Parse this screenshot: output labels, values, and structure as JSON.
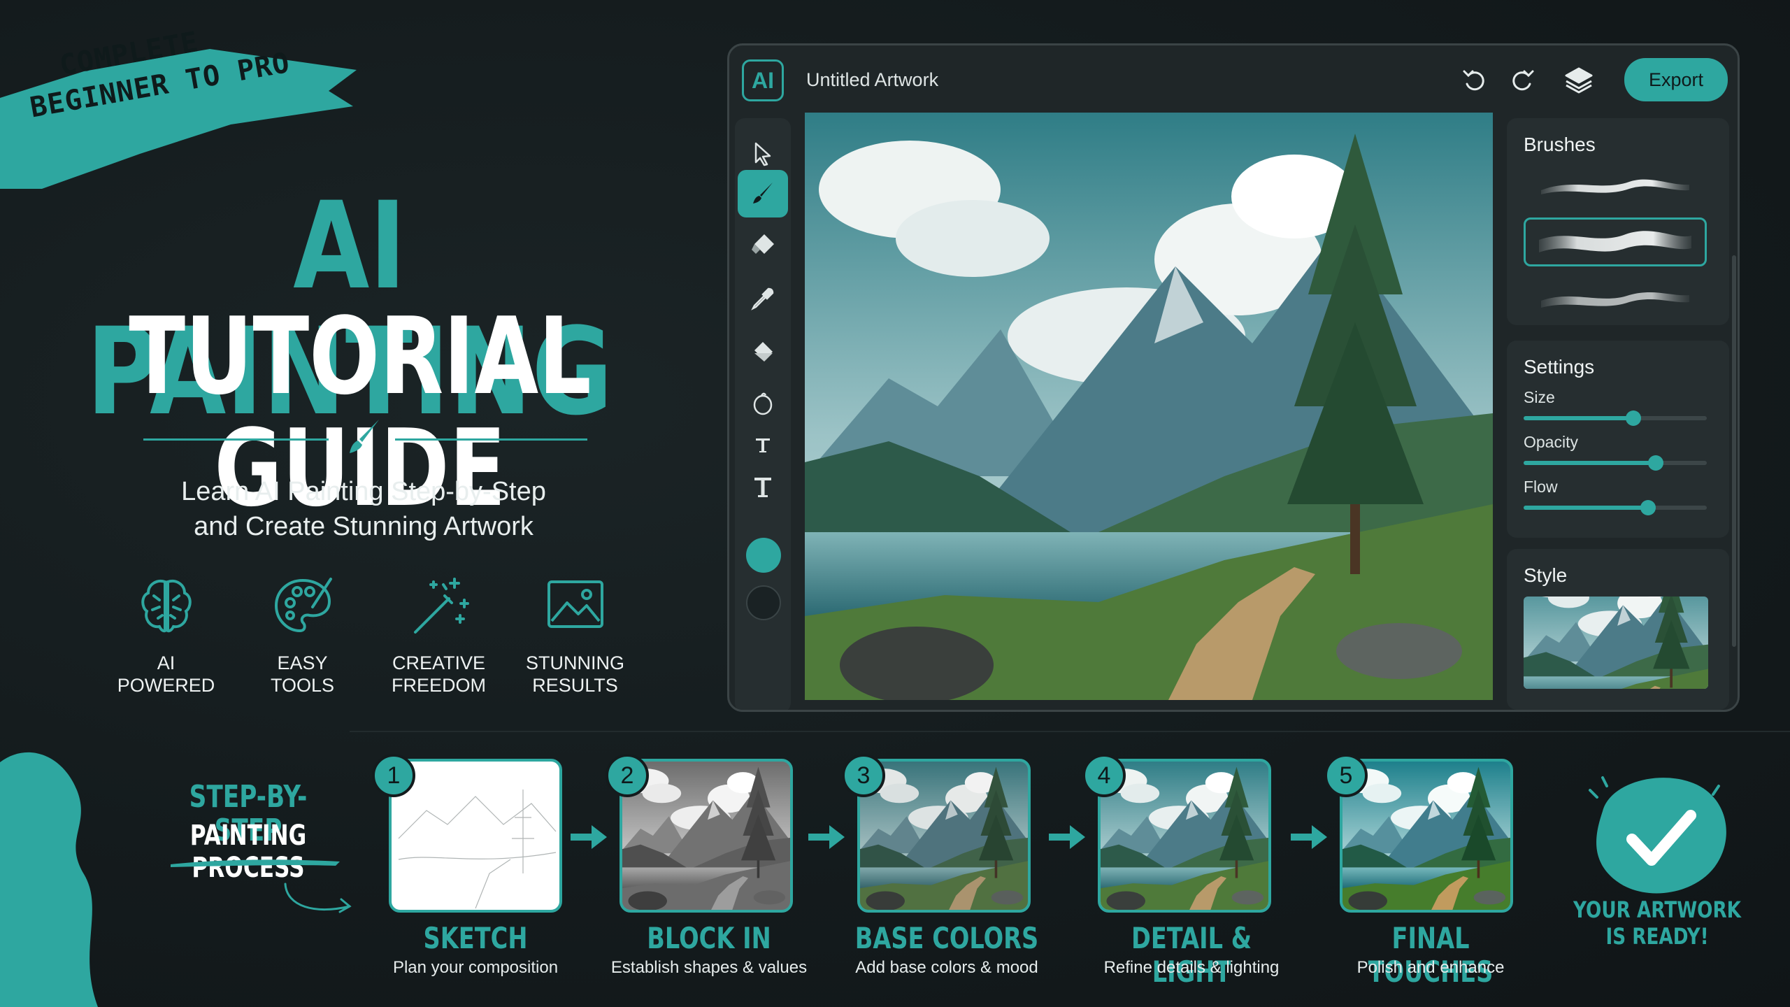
{
  "hero": {
    "ribbon_line1": "COMPLETE",
    "ribbon_line2": "BEGINNER TO PRO",
    "title_line1": "AI PAINTING",
    "title_line2": "TUTORIAL GUIDE",
    "subtitle_line1": "Learn AI Painting Step-by-Step",
    "subtitle_line2": "and Create Stunning Artwork",
    "features": [
      {
        "icon": "brain-icon",
        "line1": "AI",
        "line2": "POWERED"
      },
      {
        "icon": "palette-icon",
        "line1": "EASY",
        "line2": "TOOLS"
      },
      {
        "icon": "magic-wand-icon",
        "line1": "CREATIVE",
        "line2": "FREEDOM"
      },
      {
        "icon": "image-icon",
        "line1": "STUNNING",
        "line2": "RESULTS"
      }
    ]
  },
  "app": {
    "logo": "AI",
    "document_title": "Untitled Artwork",
    "export_label": "Export",
    "tools": [
      "select-arrow-icon",
      "brush-icon",
      "eraser-icon",
      "eyedropper-icon",
      "fill-bucket-icon",
      "lasso-icon",
      "text-small-icon",
      "text-icon"
    ],
    "active_tool": "brush-icon",
    "colors": {
      "primary": "#2ea7a0",
      "secondary": "#1a2224"
    },
    "panels": {
      "brushes_title": "Brushes",
      "selected_brush_index": 1,
      "settings_title": "Settings",
      "settings": [
        {
          "label": "Size",
          "value": 0.6
        },
        {
          "label": "Opacity",
          "value": 0.72
        },
        {
          "label": "Flow",
          "value": 0.68
        }
      ],
      "style_title": "Style"
    }
  },
  "process": {
    "title_line1": "STEP-BY-STEP",
    "title_line2": "PAINTING PROCESS",
    "steps": [
      {
        "number": "1",
        "title": "SKETCH",
        "desc": "Plan your composition"
      },
      {
        "number": "2",
        "title": "BLOCK IN",
        "desc": "Establish shapes & values"
      },
      {
        "number": "3",
        "title": "BASE COLORS",
        "desc": "Add base colors & mood"
      },
      {
        "number": "4",
        "title": "DETAIL & LIGHT",
        "desc": "Refine details & lighting"
      },
      {
        "number": "5",
        "title": "FINAL TOUCHES",
        "desc": "Polish and enhance"
      }
    ],
    "done_line1": "YOUR ARTWORK",
    "done_line2": "IS READY!"
  }
}
